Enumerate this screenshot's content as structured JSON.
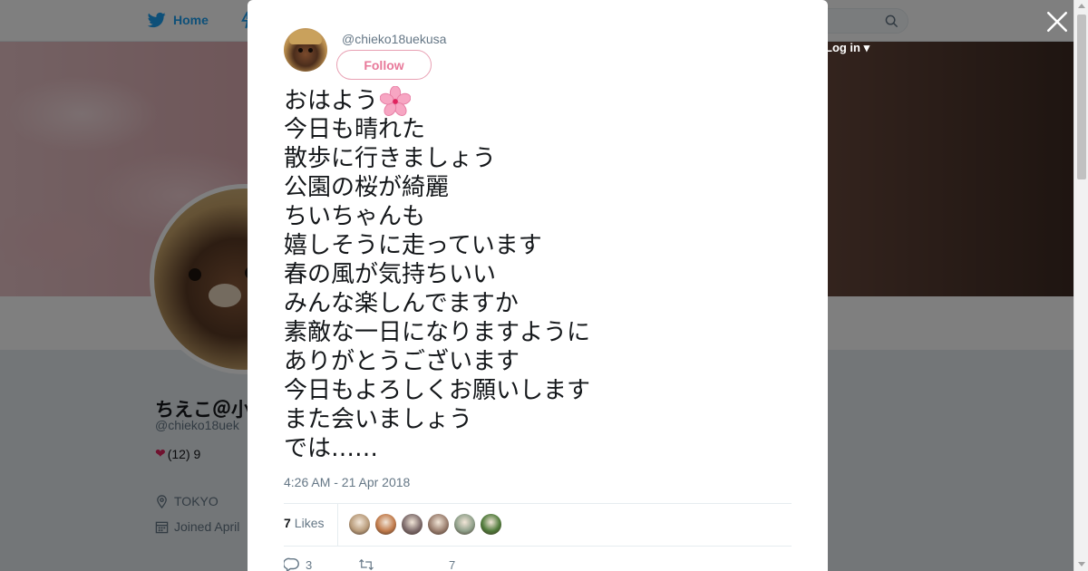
{
  "nav": {
    "home_label": "Home",
    "login_label": "Log in"
  },
  "profile": {
    "name": "ちえこ＠小さな幸せな日々",
    "handle": "@chieko18uek",
    "bio_count": "(12) 9",
    "location": "TOKYO",
    "joined": "Joined April"
  },
  "tweet": {
    "handle": "@chieko18uekusa",
    "follow_label": "Follow",
    "lines": [
      "おはよう",
      "今日も晴れた",
      "散歩に行きましょう",
      "公園の桜が綺麗",
      "ちいちゃんも",
      "嬉しそうに走っています",
      "春の風が気持ちいい",
      "みんな楽しんでますか",
      "素敵な一日になりますように",
      "ありがとうございます",
      "今日もよろしくお願いします",
      "また会いましょう",
      "では……"
    ],
    "timestamp": "4:26 AM - 21 Apr 2018",
    "likes_count": "7",
    "likes_label": "Likes",
    "reply_count": "3",
    "retweet_count": "",
    "like_count": "7",
    "liker_colors": [
      "#b89b7a",
      "#c07a4a",
      "#7d6b6b",
      "#9a7e6e",
      "#8fa08a",
      "#4f7a3a"
    ]
  },
  "colors": {
    "accent": "#1da1f2",
    "follow": "#e8799a",
    "muted": "#657786"
  }
}
